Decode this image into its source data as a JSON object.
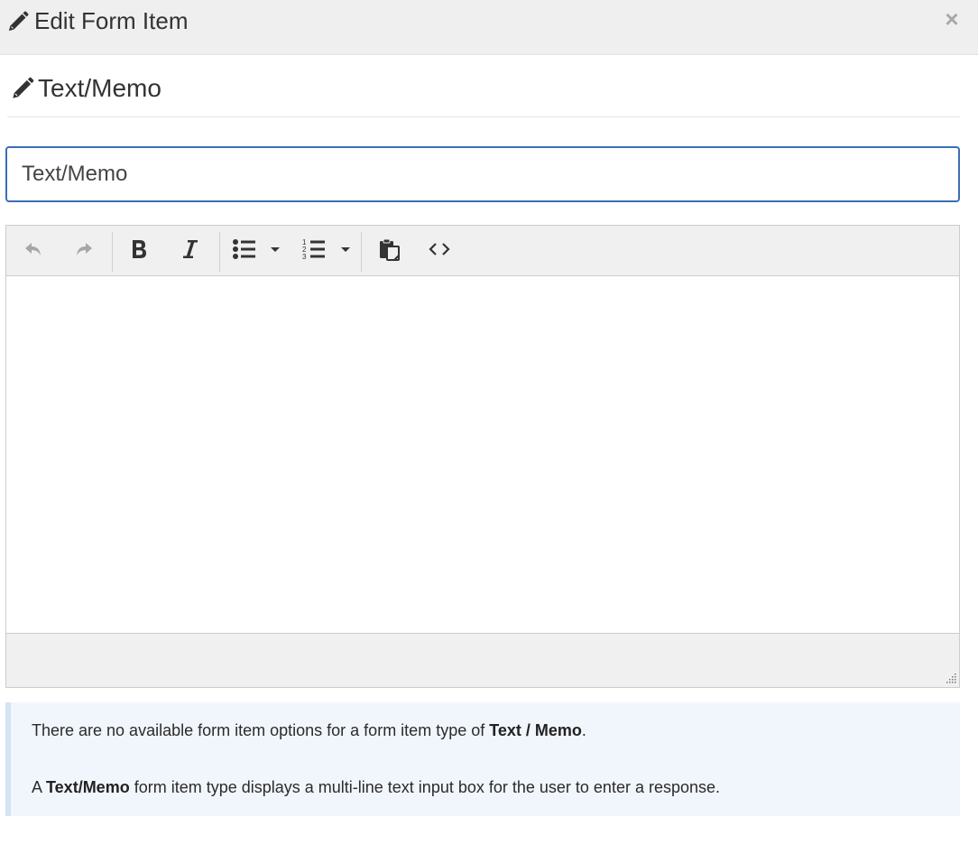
{
  "modal": {
    "title": "Edit Form Item",
    "close_glyph": "×",
    "title_icon": "pencil-icon",
    "close_icon": "close-icon"
  },
  "section": {
    "title": "Text/Memo",
    "icon": "pencil-icon"
  },
  "name_field": {
    "value": "Text/Memo"
  },
  "editor": {
    "toolbar": {
      "undo": "undo-icon",
      "redo": "redo-icon",
      "bold": "bold-icon",
      "italic": "italic-icon",
      "bullet_list": "bullet-list-icon",
      "numbered_list": "numbered-list-icon",
      "paste": "paste-icon",
      "source_code": "source-code-icon"
    },
    "body_text": ""
  },
  "info": {
    "line1_prefix": "There are no available form item options for a form item type of ",
    "line1_bold": "Text / Memo",
    "line1_suffix": ".",
    "line2_prefix": "A ",
    "line2_bold": "Text/Memo",
    "line2_suffix": " form item type displays a multi-line text input box for the user to enter a response."
  },
  "colors": {
    "header_bg": "#efefef",
    "input_border": "#3a6fb6",
    "toolbar_bg": "#f0f0f0",
    "info_bg": "#f1f6fc",
    "info_border": "#d5e3f2"
  }
}
